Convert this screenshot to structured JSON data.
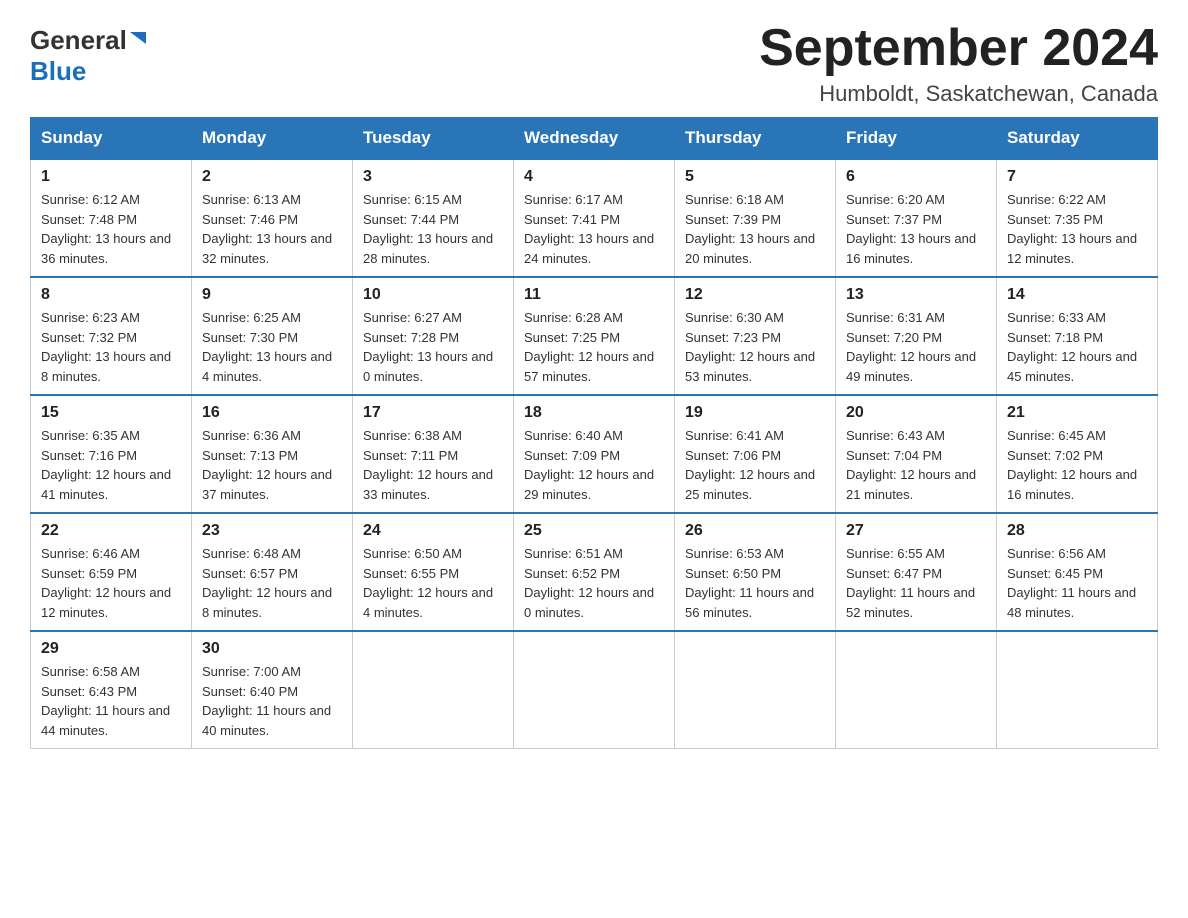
{
  "logo": {
    "general": "General",
    "blue": "Blue"
  },
  "title": "September 2024",
  "subtitle": "Humboldt, Saskatchewan, Canada",
  "columns": [
    "Sunday",
    "Monday",
    "Tuesday",
    "Wednesday",
    "Thursday",
    "Friday",
    "Saturday"
  ],
  "weeks": [
    [
      {
        "day": "1",
        "sunrise": "Sunrise: 6:12 AM",
        "sunset": "Sunset: 7:48 PM",
        "daylight": "Daylight: 13 hours and 36 minutes."
      },
      {
        "day": "2",
        "sunrise": "Sunrise: 6:13 AM",
        "sunset": "Sunset: 7:46 PM",
        "daylight": "Daylight: 13 hours and 32 minutes."
      },
      {
        "day": "3",
        "sunrise": "Sunrise: 6:15 AM",
        "sunset": "Sunset: 7:44 PM",
        "daylight": "Daylight: 13 hours and 28 minutes."
      },
      {
        "day": "4",
        "sunrise": "Sunrise: 6:17 AM",
        "sunset": "Sunset: 7:41 PM",
        "daylight": "Daylight: 13 hours and 24 minutes."
      },
      {
        "day": "5",
        "sunrise": "Sunrise: 6:18 AM",
        "sunset": "Sunset: 7:39 PM",
        "daylight": "Daylight: 13 hours and 20 minutes."
      },
      {
        "day": "6",
        "sunrise": "Sunrise: 6:20 AM",
        "sunset": "Sunset: 7:37 PM",
        "daylight": "Daylight: 13 hours and 16 minutes."
      },
      {
        "day": "7",
        "sunrise": "Sunrise: 6:22 AM",
        "sunset": "Sunset: 7:35 PM",
        "daylight": "Daylight: 13 hours and 12 minutes."
      }
    ],
    [
      {
        "day": "8",
        "sunrise": "Sunrise: 6:23 AM",
        "sunset": "Sunset: 7:32 PM",
        "daylight": "Daylight: 13 hours and 8 minutes."
      },
      {
        "day": "9",
        "sunrise": "Sunrise: 6:25 AM",
        "sunset": "Sunset: 7:30 PM",
        "daylight": "Daylight: 13 hours and 4 minutes."
      },
      {
        "day": "10",
        "sunrise": "Sunrise: 6:27 AM",
        "sunset": "Sunset: 7:28 PM",
        "daylight": "Daylight: 13 hours and 0 minutes."
      },
      {
        "day": "11",
        "sunrise": "Sunrise: 6:28 AM",
        "sunset": "Sunset: 7:25 PM",
        "daylight": "Daylight: 12 hours and 57 minutes."
      },
      {
        "day": "12",
        "sunrise": "Sunrise: 6:30 AM",
        "sunset": "Sunset: 7:23 PM",
        "daylight": "Daylight: 12 hours and 53 minutes."
      },
      {
        "day": "13",
        "sunrise": "Sunrise: 6:31 AM",
        "sunset": "Sunset: 7:20 PM",
        "daylight": "Daylight: 12 hours and 49 minutes."
      },
      {
        "day": "14",
        "sunrise": "Sunrise: 6:33 AM",
        "sunset": "Sunset: 7:18 PM",
        "daylight": "Daylight: 12 hours and 45 minutes."
      }
    ],
    [
      {
        "day": "15",
        "sunrise": "Sunrise: 6:35 AM",
        "sunset": "Sunset: 7:16 PM",
        "daylight": "Daylight: 12 hours and 41 minutes."
      },
      {
        "day": "16",
        "sunrise": "Sunrise: 6:36 AM",
        "sunset": "Sunset: 7:13 PM",
        "daylight": "Daylight: 12 hours and 37 minutes."
      },
      {
        "day": "17",
        "sunrise": "Sunrise: 6:38 AM",
        "sunset": "Sunset: 7:11 PM",
        "daylight": "Daylight: 12 hours and 33 minutes."
      },
      {
        "day": "18",
        "sunrise": "Sunrise: 6:40 AM",
        "sunset": "Sunset: 7:09 PM",
        "daylight": "Daylight: 12 hours and 29 minutes."
      },
      {
        "day": "19",
        "sunrise": "Sunrise: 6:41 AM",
        "sunset": "Sunset: 7:06 PM",
        "daylight": "Daylight: 12 hours and 25 minutes."
      },
      {
        "day": "20",
        "sunrise": "Sunrise: 6:43 AM",
        "sunset": "Sunset: 7:04 PM",
        "daylight": "Daylight: 12 hours and 21 minutes."
      },
      {
        "day": "21",
        "sunrise": "Sunrise: 6:45 AM",
        "sunset": "Sunset: 7:02 PM",
        "daylight": "Daylight: 12 hours and 16 minutes."
      }
    ],
    [
      {
        "day": "22",
        "sunrise": "Sunrise: 6:46 AM",
        "sunset": "Sunset: 6:59 PM",
        "daylight": "Daylight: 12 hours and 12 minutes."
      },
      {
        "day": "23",
        "sunrise": "Sunrise: 6:48 AM",
        "sunset": "Sunset: 6:57 PM",
        "daylight": "Daylight: 12 hours and 8 minutes."
      },
      {
        "day": "24",
        "sunrise": "Sunrise: 6:50 AM",
        "sunset": "Sunset: 6:55 PM",
        "daylight": "Daylight: 12 hours and 4 minutes."
      },
      {
        "day": "25",
        "sunrise": "Sunrise: 6:51 AM",
        "sunset": "Sunset: 6:52 PM",
        "daylight": "Daylight: 12 hours and 0 minutes."
      },
      {
        "day": "26",
        "sunrise": "Sunrise: 6:53 AM",
        "sunset": "Sunset: 6:50 PM",
        "daylight": "Daylight: 11 hours and 56 minutes."
      },
      {
        "day": "27",
        "sunrise": "Sunrise: 6:55 AM",
        "sunset": "Sunset: 6:47 PM",
        "daylight": "Daylight: 11 hours and 52 minutes."
      },
      {
        "day": "28",
        "sunrise": "Sunrise: 6:56 AM",
        "sunset": "Sunset: 6:45 PM",
        "daylight": "Daylight: 11 hours and 48 minutes."
      }
    ],
    [
      {
        "day": "29",
        "sunrise": "Sunrise: 6:58 AM",
        "sunset": "Sunset: 6:43 PM",
        "daylight": "Daylight: 11 hours and 44 minutes."
      },
      {
        "day": "30",
        "sunrise": "Sunrise: 7:00 AM",
        "sunset": "Sunset: 6:40 PM",
        "daylight": "Daylight: 11 hours and 40 minutes."
      },
      null,
      null,
      null,
      null,
      null
    ]
  ]
}
